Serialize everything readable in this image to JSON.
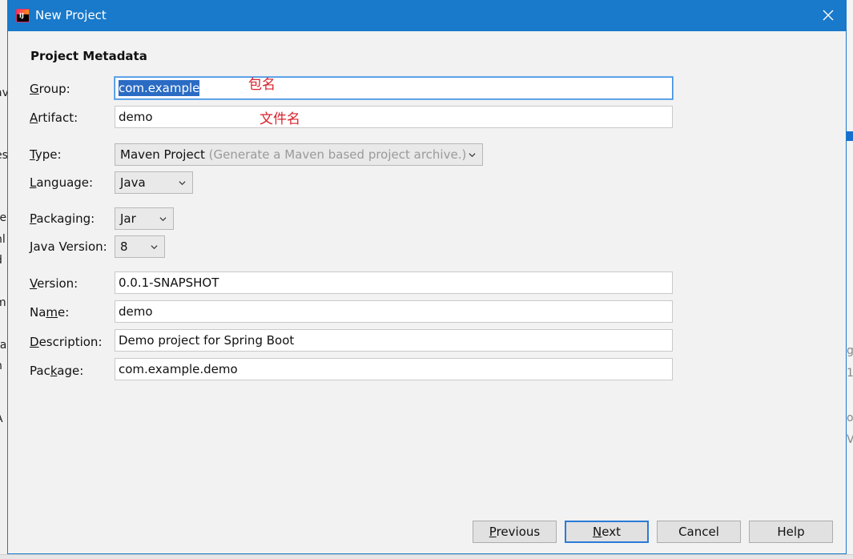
{
  "window": {
    "title": "New Project",
    "app_icon_text": "IJ"
  },
  "section_title": "Project Metadata",
  "fields": {
    "group": {
      "label_pre": "",
      "label_mn": "G",
      "label_post": "roup:",
      "value": "com.example"
    },
    "artifact": {
      "label_pre": "",
      "label_mn": "A",
      "label_post": "rtifact:",
      "value": "demo"
    },
    "type": {
      "label_pre": "",
      "label_mn": "T",
      "label_post": "ype:",
      "value": "Maven Project",
      "hint": "(Generate a Maven based project archive.)"
    },
    "language": {
      "label_pre": "",
      "label_mn": "L",
      "label_post": "anguage:",
      "value": "Java"
    },
    "packaging": {
      "label_pre": "",
      "label_mn": "P",
      "label_post": "ackaging:",
      "value": "Jar"
    },
    "java_version": {
      "label_pre": "",
      "label_mn": "J",
      "label_post": "ava Version:",
      "value": "8"
    },
    "version": {
      "label_pre": "",
      "label_mn": "V",
      "label_post": "ersion:",
      "value": "0.0.1-SNAPSHOT"
    },
    "name": {
      "label_pre": "Na",
      "label_mn": "m",
      "label_post": "e:",
      "value": "demo"
    },
    "description": {
      "label_pre": "",
      "label_mn": "D",
      "label_post": "escription:",
      "value": "Demo project for Spring Boot"
    },
    "package": {
      "label_pre": "Pac",
      "label_mn": "k",
      "label_post": "age:",
      "value": "com.example.demo"
    }
  },
  "annotations": {
    "group_note": "包名",
    "artifact_note": "文件名"
  },
  "buttons": {
    "previous": {
      "mn": "P",
      "rest": "revious"
    },
    "next": {
      "mn": "N",
      "rest": "ext"
    },
    "cancel": "Cancel",
    "help": "Help"
  },
  "colors": {
    "titlebar": "#1979ca",
    "selection": "#2a6bc4",
    "annotation": "#d8202a",
    "focus_ring": "#3d8ee0"
  },
  "background_fragments": {
    "left": [
      "av",
      "es",
      "re",
      "nl",
      "d",
      "m",
      "l",
      "ra",
      "n",
      "A"
    ],
    "right": [
      "g",
      "1",
      "o",
      "V"
    ]
  }
}
